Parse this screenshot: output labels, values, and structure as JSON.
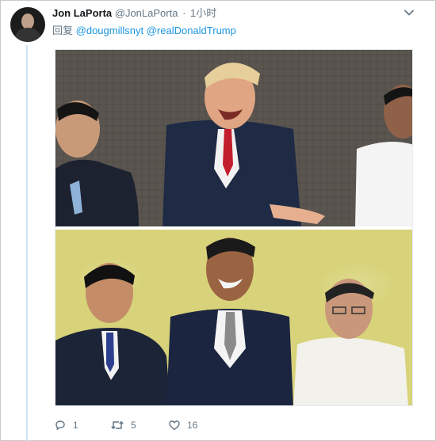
{
  "tweet": {
    "author_name": "Jon LaPorta",
    "author_handle": "@JonLaPorta",
    "separator": "·",
    "time": "1小时",
    "reply_prefix": "回复",
    "mentions": [
      "@dougmillsnyt",
      "@realDonaldTrump"
    ]
  },
  "actions": {
    "reply_count": "1",
    "retweet_count": "5",
    "like_count": "16"
  },
  "icons": {
    "menu": "chevron-down-icon",
    "reply": "reply-icon",
    "retweet": "retweet-icon",
    "like": "heart-icon"
  },
  "colors": {
    "link": "#1b95e0",
    "muted": "#657786",
    "thread_line": "#cfe3f3"
  }
}
